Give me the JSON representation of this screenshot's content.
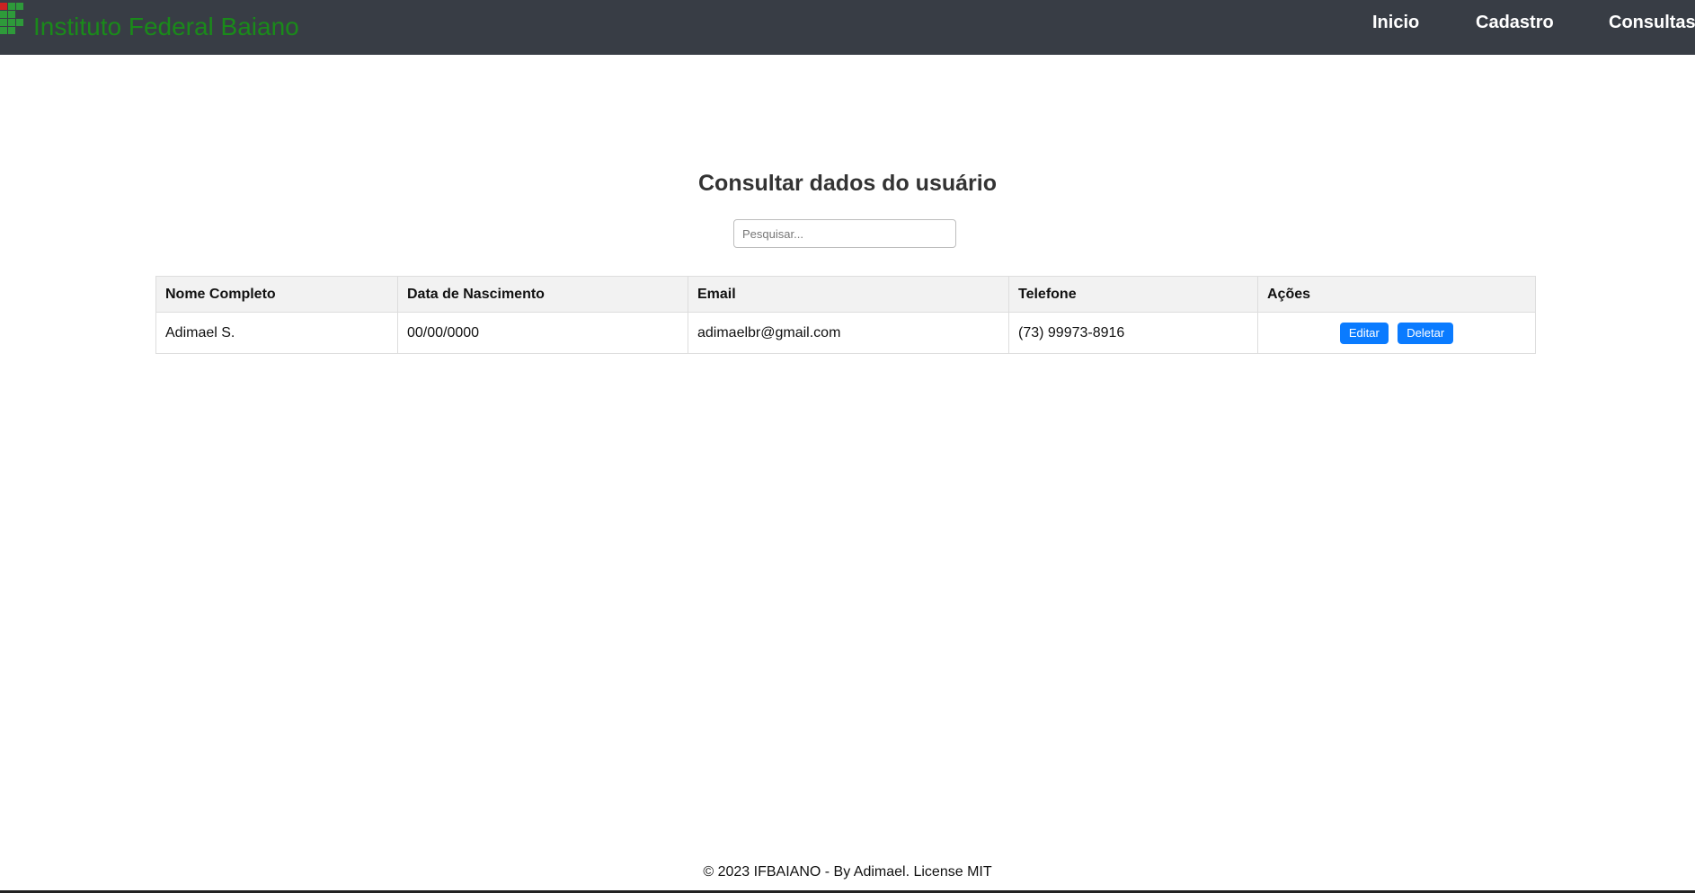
{
  "header": {
    "brand_name": "Instituto Federal Baiano",
    "logo_icon": "ifbaiano-logo-icon",
    "nav": [
      {
        "label": "Inicio"
      },
      {
        "label": "Cadastro"
      },
      {
        "label": "Consultas"
      }
    ],
    "colors": {
      "bar": "#383d45",
      "brand_text": "#1a8a1a",
      "logo_green": "#2e9a3a",
      "logo_red": "#cc2222"
    }
  },
  "main": {
    "title": "Consultar dados do usuário",
    "search": {
      "placeholder": "Pesquisar...",
      "value": ""
    },
    "table": {
      "columns": [
        "Nome Completo",
        "Data de Nascimento",
        "Email",
        "Telefone",
        "Ações"
      ],
      "rows": [
        {
          "nome": "Adimael S.",
          "nascimento": "00/00/0000",
          "email": "adimaelbr@gmail.com",
          "telefone": "(73) 99973-8916",
          "actions": {
            "edit_label": "Editar",
            "delete_label": "Deletar"
          }
        }
      ]
    },
    "colors": {
      "button": "#0a7bff",
      "header_bg": "#f2f2f2"
    }
  },
  "footer": {
    "text": "© 2023 IFBAIANO - By Adimael. License MIT"
  }
}
